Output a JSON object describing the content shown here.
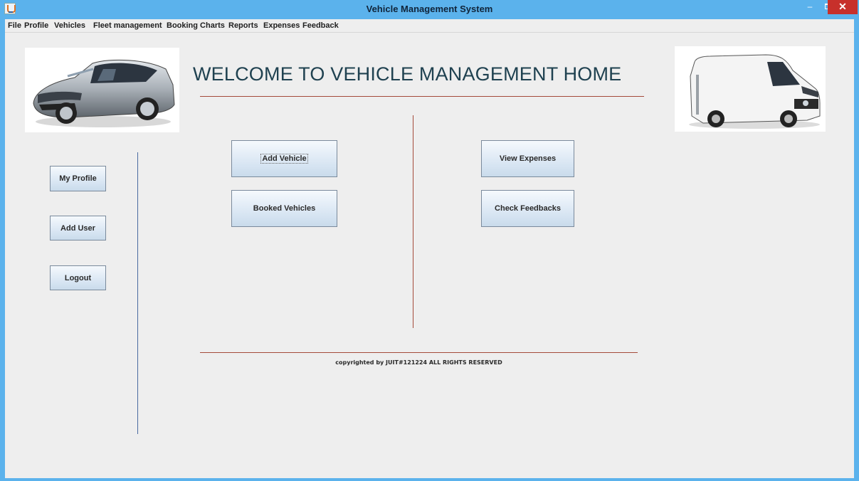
{
  "window": {
    "title": "Vehicle Management System",
    "controls": {
      "minimize": "–",
      "close": "✕"
    }
  },
  "menu": [
    "File",
    "Profile",
    "Vehicles",
    "Fleet management",
    "Booking Charts",
    "Reports",
    "Expenses",
    "Feedback"
  ],
  "header": {
    "welcome": "WELCOME TO VEHICLE MANAGEMENT HOME"
  },
  "sidebar": {
    "my_profile": "My Profile",
    "add_user": "Add User",
    "logout": "Logout"
  },
  "actions": {
    "add_vehicle": "Add Vehicle",
    "booked_vehicles": "Booked Vehicles",
    "view_expenses": "View Expenses",
    "check_feedbacks": "Check Feedbacks"
  },
  "footer": {
    "copyright": "copyrighted by JUIT#121224 ALL RIGHTS RESERVED"
  },
  "colors": {
    "titlebar": "#5bb2ec",
    "close": "#c7302b",
    "divider_red": "#a44a3a",
    "divider_blue": "#4a6aa0",
    "heading": "#1f4150"
  }
}
